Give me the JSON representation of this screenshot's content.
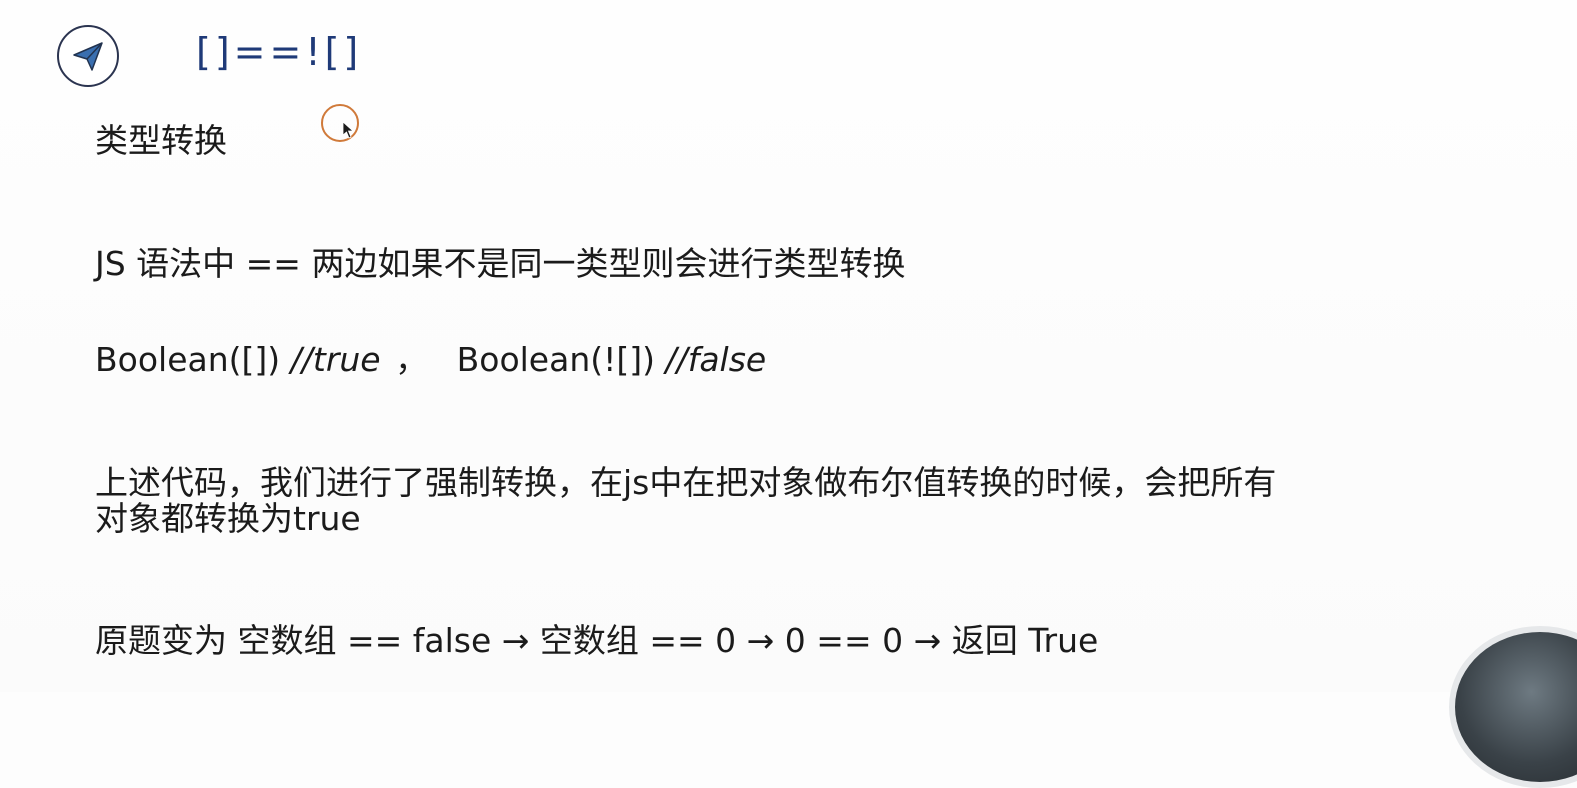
{
  "slide": {
    "title": "[]==![]",
    "logo_icon": "paper-plane-icon",
    "heading": "类型转换",
    "js_rule": "JS 语法中 == 两边如果不是同一类型则会进行类型转换",
    "boolean_line": {
      "expr1": "Boolean([])",
      "comment1": "//true",
      "separator": "，",
      "expr2": "Boolean(![])",
      "comment2": "//false"
    },
    "description": {
      "line1": "上述代码，我们进行了强制转换，在js中在把对象做布尔值转换的时候，会把所有",
      "line2": "对象都转换为true"
    },
    "result": "原题变为 空数组 == false → 空数组 == 0 → 0 == 0 → 返回 True"
  },
  "colors": {
    "title": "#1f3a78",
    "logo_fill": "#3a6fb0",
    "logo_border": "#2b3450",
    "cursor_ring": "#d07a3a",
    "text": "#1b1b1b"
  }
}
